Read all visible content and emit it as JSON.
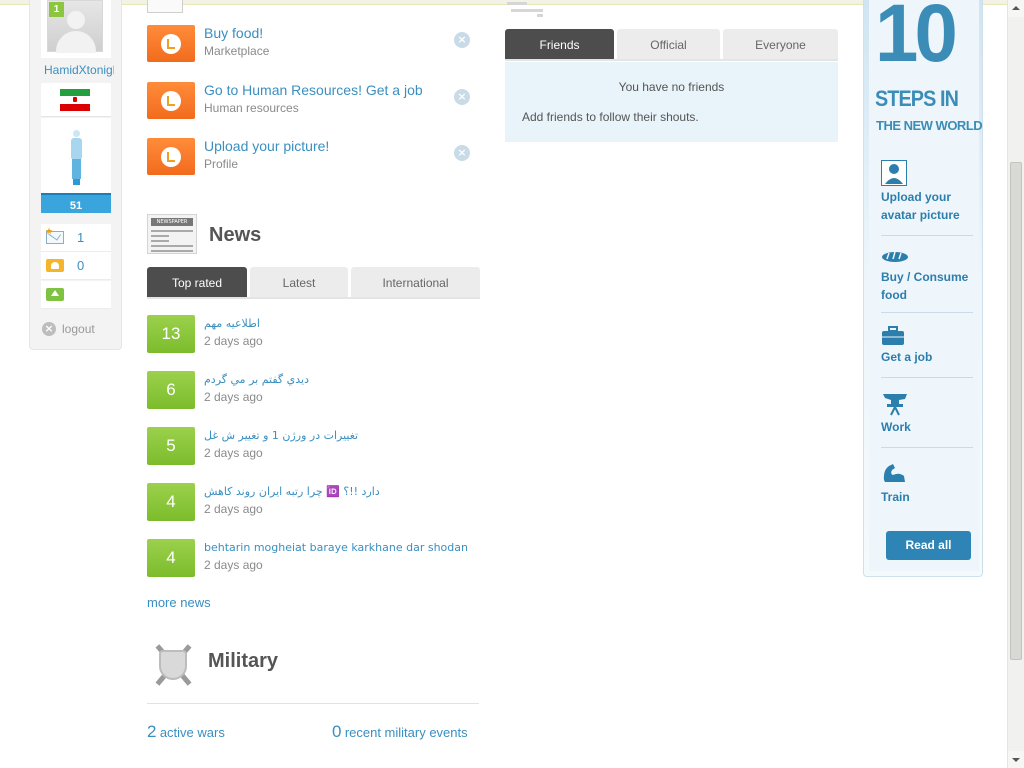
{
  "sidebar": {
    "level": "1",
    "username": "HamidXtonight",
    "energy": "51",
    "messages_count": "1",
    "alerts_count": "0",
    "logout_label": "logout"
  },
  "tasks": [
    {
      "title": "Buy food!",
      "subtitle": "Marketplace"
    },
    {
      "title": "Go to Human Resources! Get a job",
      "subtitle": "Human resources"
    },
    {
      "title": "Upload your picture!",
      "subtitle": "Profile"
    }
  ],
  "news": {
    "icon_text": "NEWSPAPER",
    "title": "News",
    "tabs": [
      "Top rated",
      "Latest",
      "International"
    ],
    "items": [
      {
        "votes": "13",
        "title": "اطلاعیه مهم",
        "time": "2 days ago"
      },
      {
        "votes": "6",
        "title": "ديدي گفتم بر مي گردم",
        "time": "2 days ago"
      },
      {
        "votes": "5",
        "title": "تغییرات در ورژن 1 و تغییر ش غل",
        "time": "2 days ago"
      },
      {
        "votes": "4",
        "title": "چرا رتبه ایران روند کاهش 🆔 دارد !!؟",
        "time": "2 days ago"
      },
      {
        "votes": "4",
        "title": "behtarin mogheiat baraye karkhane dar shodan",
        "time": "2 days ago"
      }
    ],
    "more_label": "more news"
  },
  "military": {
    "title": "Military",
    "active_wars_count": "2",
    "active_wars_label": "active wars",
    "events_count": "0",
    "events_label": "recent military events"
  },
  "shouts": {
    "tabs": [
      "Friends",
      "Official",
      "Everyone"
    ],
    "empty_message": "You have no friends",
    "hint": "Add friends to follow their shouts."
  },
  "steps": {
    "big_number": "10",
    "heading_line1": "STEPS IN",
    "heading_line2": "THE NEW WORLD",
    "items": [
      {
        "label": "Upload your avatar picture",
        "icon": "user-icon"
      },
      {
        "label": "Buy / Consume food",
        "icon": "bread-icon"
      },
      {
        "label": "Get a job",
        "icon": "briefcase-icon"
      },
      {
        "label": "Work",
        "icon": "anvil-icon"
      },
      {
        "label": "Train",
        "icon": "muscle-icon"
      }
    ],
    "read_all_label": "Read all"
  },
  "colors": {
    "link": "#3a8fc0",
    "task_orange": "#f26b1d",
    "vote_green": "#8cc63f",
    "energy_blue": "#3aa5dd",
    "steps_blue": "#3b8db8"
  }
}
